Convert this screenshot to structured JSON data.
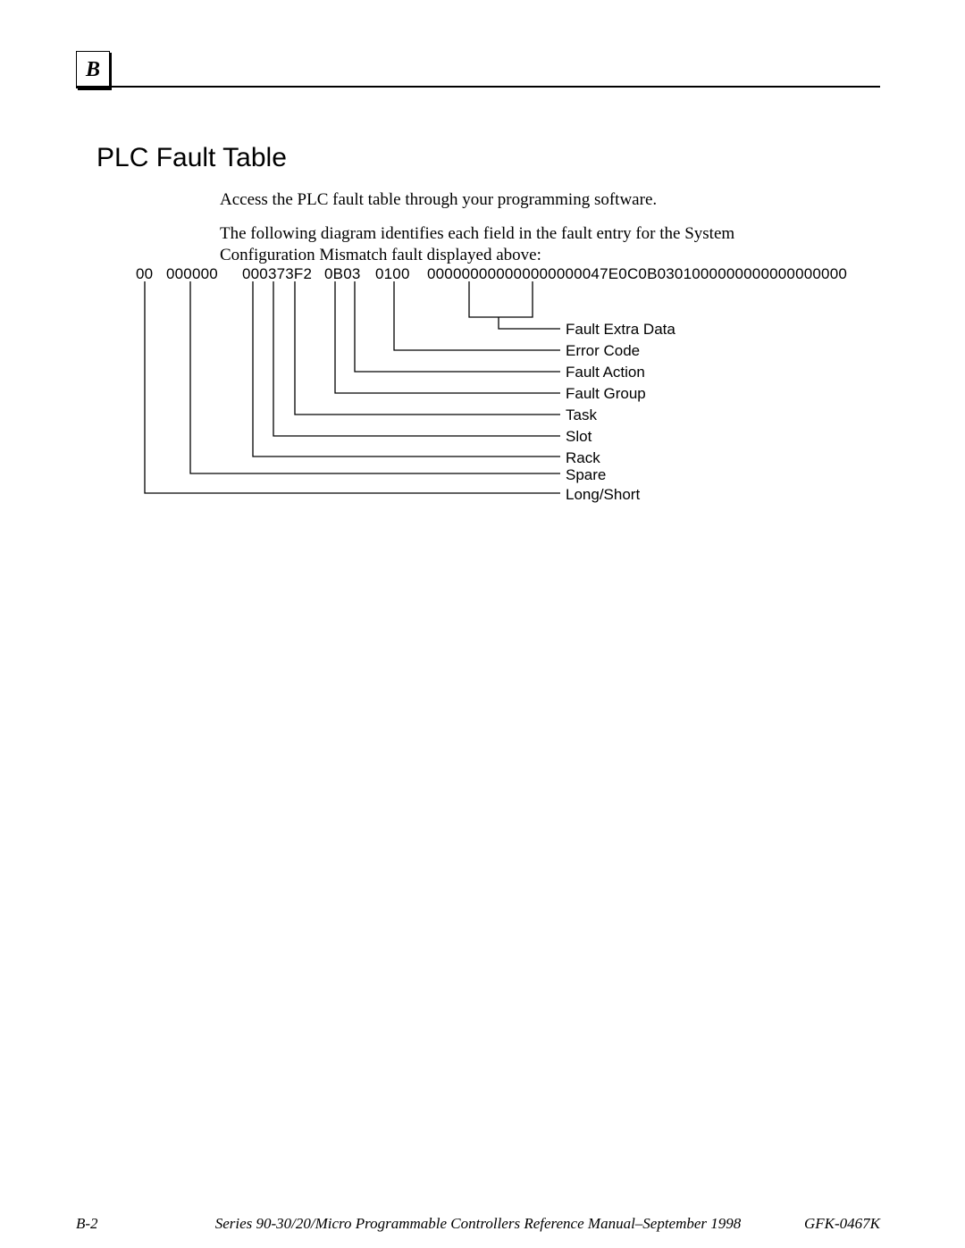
{
  "header_letter": "B",
  "title": "PLC Fault Table",
  "para1": "Access the PLC fault table through your programming software.",
  "para2": "The following diagram identifies each field in the fault entry for the System Configuration Mismatch fault displayed above:",
  "hex": {
    "long_short": "00",
    "spare": "000000",
    "rack_slot_task": "000373F2",
    "group_action": "0B03",
    "error_code": "0100",
    "extra": "000000000000000000047E0C0B0301000000000000000000"
  },
  "labels": [
    "Fault Extra Data",
    "Error Code",
    "Fault Action",
    "Fault  Group",
    "Task",
    "Slot",
    "Rack",
    "Spare",
    "Long/Short"
  ],
  "footer": {
    "page": "B-2",
    "title": "Series 90-30/20/Micro Programmable Controllers Reference Manual–September 1998",
    "doc": "GFK-0467K"
  }
}
